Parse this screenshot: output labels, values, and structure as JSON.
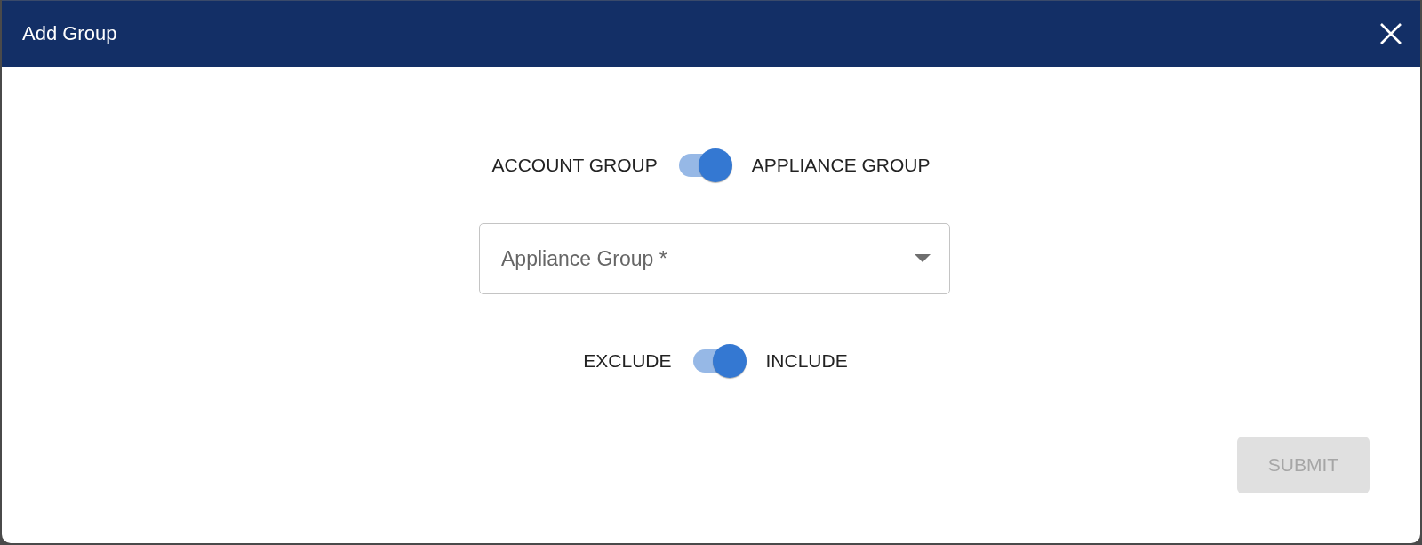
{
  "dialog": {
    "title": "Add Group"
  },
  "switches": [
    {
      "left_label": "ACCOUNT GROUP",
      "right_label": "APPLIANCE GROUP",
      "on": true
    },
    {
      "left_label": "EXCLUDE",
      "right_label": "INCLUDE",
      "on": true
    }
  ],
  "select": {
    "placeholder": "Appliance Group *"
  },
  "submit": {
    "label": "SUBMIT",
    "disabled": true
  }
}
